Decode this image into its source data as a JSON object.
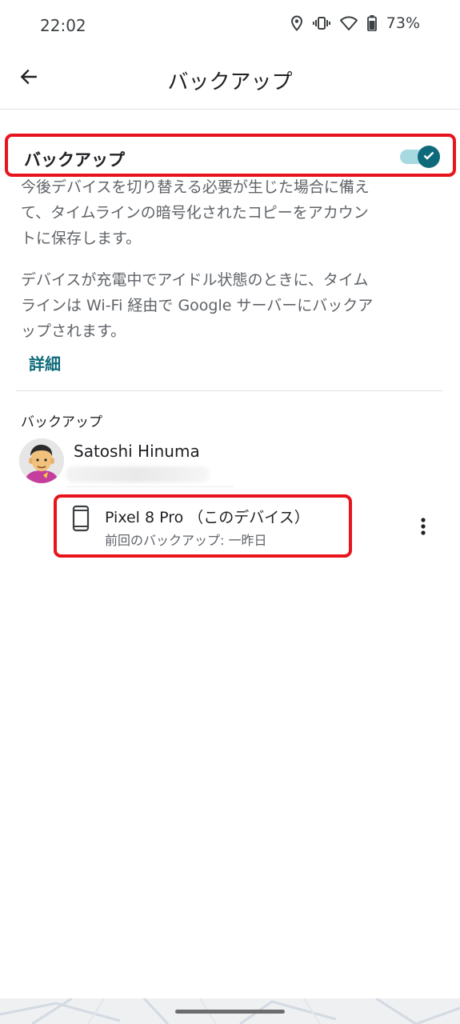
{
  "status_bar": {
    "time": "22:02",
    "battery": "73%",
    "icons": [
      "location-icon",
      "vibrate-icon",
      "wifi-icon",
      "battery-icon"
    ]
  },
  "app_bar": {
    "title": "バックアップ",
    "back_icon": "arrow-back-icon"
  },
  "backup_toggle": {
    "label": "バックアップ",
    "enabled": true,
    "accent": "#0e6a7a"
  },
  "descriptions": {
    "first": "今後デバイスを切り替える必要が生じた場合に備えて、タイムラインの暗号化されたコピーをアカウントに保存します。",
    "second": "デバイスが充電中でアイドル状態のときに、タイムラインは Wi-Fi 経由で Google サーバーにバックアップされます。"
  },
  "details_link": "詳細",
  "section": {
    "header": "バックアップ"
  },
  "account": {
    "name": "Satoshi Hinuma"
  },
  "device": {
    "name": "Pixel 8 Pro （このデバイス）",
    "last_backup": "前回のバックアップ: 一昨日",
    "icon": "phone-icon",
    "menu_icon": "more-vert-icon"
  },
  "highlight_color": "#e8141c"
}
